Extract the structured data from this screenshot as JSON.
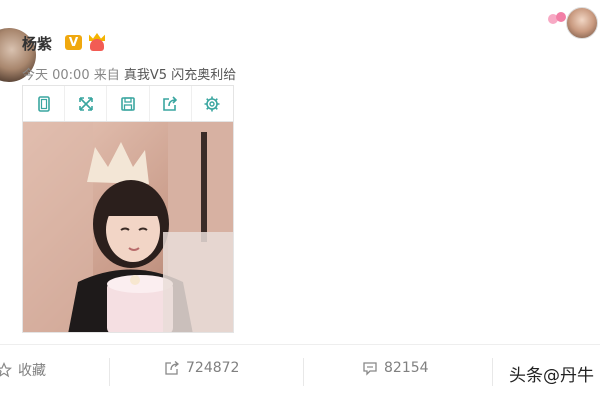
{
  "post": {
    "username": "杨紫",
    "verified_badge": "V",
    "time": "今天 00:00",
    "source_prefix": "来自",
    "source": "真我V5 闪充奥利给"
  },
  "toolbar": {
    "icons": [
      "phone-frame-icon",
      "expand-icon",
      "save-icon",
      "share-out-icon",
      "gear-icon"
    ]
  },
  "actions": {
    "favorite_label": "收藏",
    "repost_count": "724872",
    "comment_count": "82154"
  },
  "watermark": "头条@丹牛",
  "colors": {
    "icon_teal": "#3aa6a0",
    "muted_text": "#808080"
  }
}
